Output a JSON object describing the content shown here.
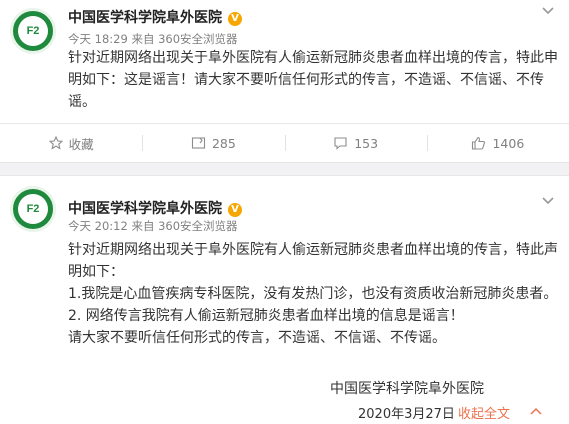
{
  "posts": [
    {
      "author": "中国医学科学院阜外医院",
      "avatar_text": "F2",
      "meta": "今天 18:29 来自 360安全浏览器",
      "lines": [
        "针对近期网络出现关于阜外医院有人偷运新冠肺炎患者血样出境的传言，特此申",
        "明如下：这是谣言！请大家不要听信任何形式的传言，不造谣、不信谣、不传",
        "谣。"
      ],
      "actions": {
        "favorite": "收藏",
        "repost": "285",
        "comment": "153",
        "like": "1406"
      }
    },
    {
      "author": "中国医学科学院阜外医院",
      "avatar_text": "F2",
      "meta": "今天 20:12 来自 360安全浏览器",
      "lines": [
        "针对近期网络出现关于阜外医院有人偷运新冠肺炎患者血样出境的传言，特此声",
        "明如下：",
        "1.我院是心血管疾病专科医院，没有发热门诊，也没有资质收治新冠肺炎患者。",
        "2. 网络传言我院有人偷运新冠肺炎患者血样出境的信息是谣言！",
        "请大家不要听信任何形式的传言，不造谣、不信谣、不传谣。"
      ],
      "signature": "中国医学科学院阜外医院",
      "date": "2020年3月27日",
      "collapse_label": "收起全文"
    }
  ],
  "colors": {
    "avatar_green": "#1f8a3d",
    "verified_badge": "#f7a600",
    "link_orange": "#eb7350",
    "meta_gray": "#808080"
  },
  "icons": {
    "verified": "verified-v-badge",
    "dropdown": "chevron-down-icon",
    "favorite": "star-icon",
    "repost": "repost-icon",
    "comment": "comment-icon",
    "like": "thumbs-up-icon",
    "collapse": "chevron-up-icon"
  }
}
